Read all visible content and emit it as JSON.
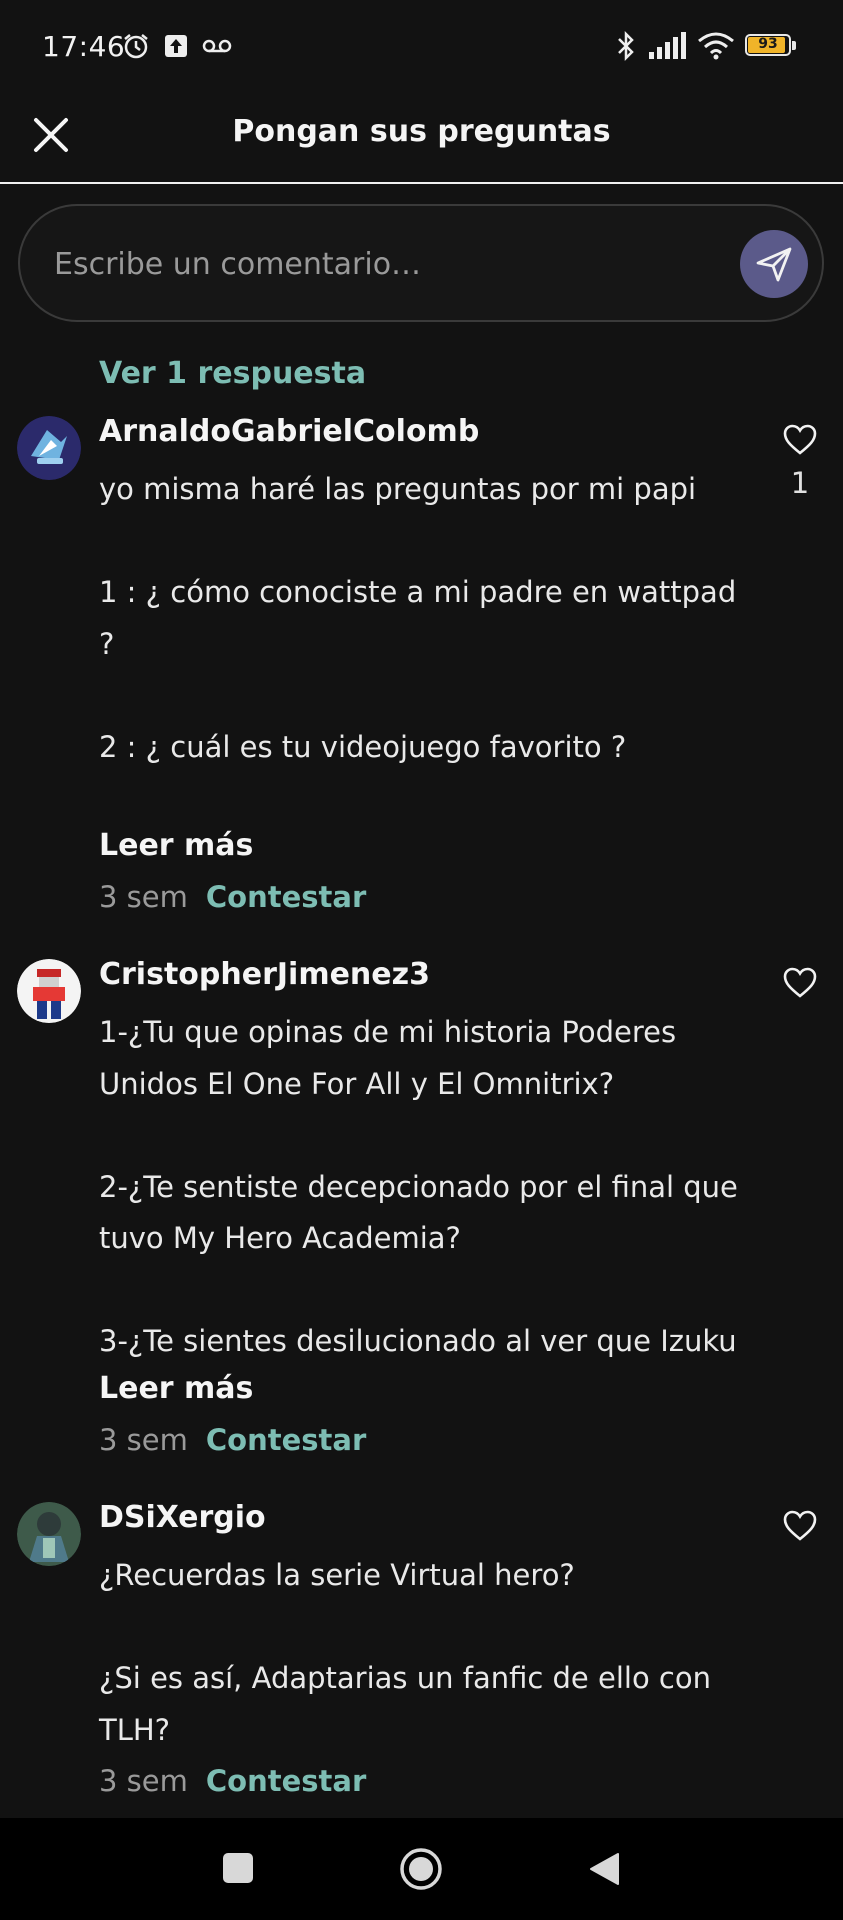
{
  "status_bar": {
    "time": "17:46",
    "battery": "93",
    "icons_left": [
      "alarm-icon",
      "upload-icon",
      "voicemail-icon"
    ],
    "icons_right": [
      "bluetooth-icon",
      "signal-icon",
      "wifi-icon",
      "battery-icon"
    ],
    "battery_color": "#f0b429"
  },
  "header": {
    "title": "Pongan sus preguntas"
  },
  "composer": {
    "placeholder": "Escribe un comentario…"
  },
  "view_replies": "Ver 1 respuesta",
  "comments": [
    {
      "username": "ArnaldoGabrielColomb",
      "text": "yo misma haré las preguntas por mi papi\n\n1 : ¿ cómo conociste a mi padre en wattpad ?\n\n2 : ¿ cuál es tu videojuego favorito ?",
      "likes": "1",
      "read_more": "Leer más",
      "time": "3 sem",
      "reply": "Contestar"
    },
    {
      "username": "CristopherJimenez3",
      "text": "1-¿Tu que opinas de mi historia Poderes Unidos El One For All y El Omnitrix?\n\n2-¿Te sentiste decepcionado por el final que tuvo My Hero Academia?\n\n3-¿Te sientes desilucionado al ver que Izuku",
      "read_more": "Leer más",
      "time": "3 sem",
      "reply": "Contestar"
    },
    {
      "username": "DSiXergio",
      "text": "¿Recuerdas la serie Virtual hero?\n\n¿Si es así, Adaptarias un fanfic de ello con TLH?",
      "time": "3 sem",
      "reply": "Contestar"
    }
  ],
  "colors": {
    "background": "#121212",
    "accent": "#7dbdb3",
    "send_button": "#5b5a8a"
  }
}
